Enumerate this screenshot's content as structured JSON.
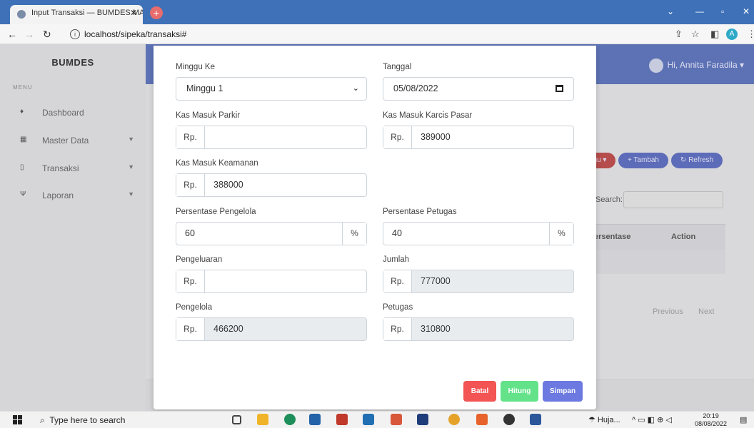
{
  "browser": {
    "tab_title": "Input Transaksi — BUMDES MAJ",
    "url": "localhost/sipeka/transaksi#"
  },
  "app": {
    "brand": "BUMDES",
    "menu_heading": "MENU",
    "sidebar": [
      {
        "label": "Dashboard",
        "icon": "tint-icon"
      },
      {
        "label": "Master Data",
        "icon": "grid-icon"
      },
      {
        "label": "Transaksi",
        "icon": "file-icon"
      },
      {
        "label": "Laporan",
        "icon": "plug-icon"
      }
    ],
    "user_greeting": "Hi, Annita Faradila",
    "bg_buttons": {
      "filter": "gu",
      "tambah": "Tambah",
      "refresh": "Refresh"
    },
    "bg_search_label": "Search:",
    "bg_table_headers": [
      "ersentase",
      "Action"
    ],
    "bg_pagination": [
      "Previous",
      "Next"
    ]
  },
  "form": {
    "minggu_ke": {
      "label": "Minggu Ke",
      "value": "Minggu 1"
    },
    "tanggal": {
      "label": "Tanggal",
      "value": "05/08/2022"
    },
    "kas_parkir": {
      "label": "Kas Masuk Parkir",
      "prefix": "Rp.",
      "value": ""
    },
    "kas_karcis": {
      "label": "Kas Masuk Karcis Pasar",
      "prefix": "Rp.",
      "value": "389000"
    },
    "kas_keamanan": {
      "label": "Kas Masuk Keamanan",
      "prefix": "Rp.",
      "value": "388000"
    },
    "persen_pengelola": {
      "label": "Persentase Pengelola",
      "value": "60",
      "suffix": "%"
    },
    "persen_petugas": {
      "label": "Persentase Petugas",
      "value": "40",
      "suffix": "%"
    },
    "pengeluaran": {
      "label": "Pengeluaran",
      "prefix": "Rp.",
      "value": ""
    },
    "jumlah": {
      "label": "Jumlah",
      "prefix": "Rp.",
      "value": "777000"
    },
    "pengelola": {
      "label": "Pengelola",
      "prefix": "Rp.",
      "value": "466200"
    },
    "petugas": {
      "label": "Petugas",
      "prefix": "Rp.",
      "value": "310800"
    }
  },
  "buttons": {
    "batal": "Batal",
    "hitung": "Hitung",
    "simpan": "Simpan"
  },
  "colors": {
    "batal": "#f35454",
    "hitung": "#63e28a",
    "simpan": "#6c79e0"
  },
  "taskbar": {
    "search_placeholder": "Type here to search",
    "weather": "Huja...",
    "time": "20:19",
    "date": "08/08/2022"
  }
}
